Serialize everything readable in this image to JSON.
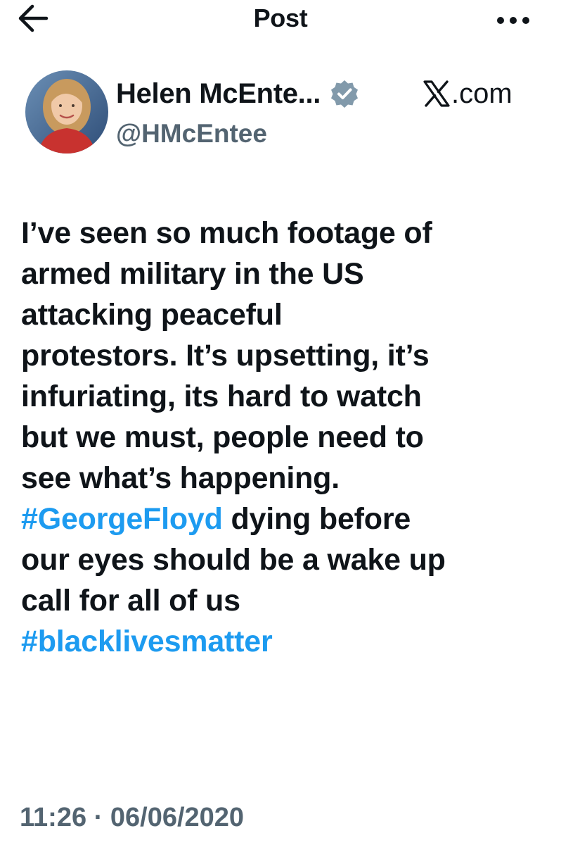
{
  "header": {
    "title": "Post",
    "back_icon": "arrow-left-icon",
    "more_icon": "more-horizontal-icon"
  },
  "author": {
    "display_name": "Helen McEnte...",
    "handle": "@HMcEntee",
    "verified_icon": "verified-badge-icon",
    "source_logo": "x-logo-icon",
    "source_text": ".com"
  },
  "post": {
    "line1": "I’ve seen so much footage of",
    "line2": "armed military in the US",
    "line3": "attacking peaceful",
    "line4": "protestors. It’s upsetting, it’s",
    "line5": "infuriating, its hard to watch",
    "line6": "but we must, people need to",
    "line7": "see what’s happening.",
    "hashtag1": "#GeorgeFloyd",
    "line8_rest": " dying before",
    "line9": "our eyes should be a wake up",
    "line10": "call for all of us",
    "hashtag2": "#blacklivesmatter"
  },
  "meta": {
    "timestamp": "11:26 · 06/06/2020"
  },
  "colors": {
    "text": "#0f1419",
    "secondary": "#536471",
    "link": "#1d9bf0",
    "verified": "#829aab"
  }
}
